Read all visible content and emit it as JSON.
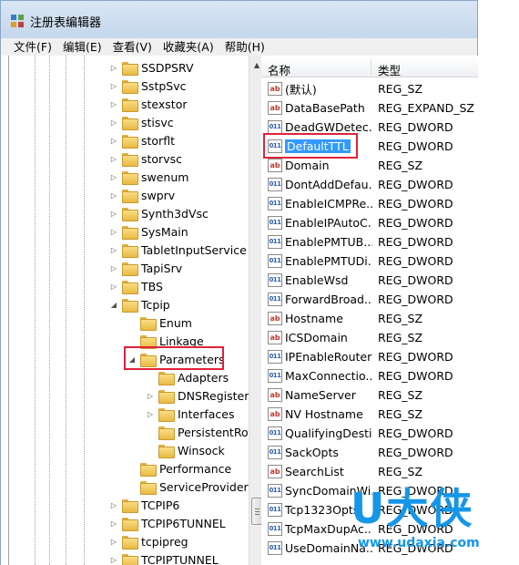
{
  "window": {
    "title": "注册表编辑器"
  },
  "menu": [
    "文件(F)",
    "编辑(E)",
    "查看(V)",
    "收藏夹(A)",
    "帮助(H)"
  ],
  "tree": {
    "items": [
      {
        "label": "SSDPSRV",
        "level": 0,
        "expander": "▷"
      },
      {
        "label": "SstpSvc",
        "level": 0,
        "expander": "▷"
      },
      {
        "label": "stexstor",
        "level": 0,
        "expander": "▷"
      },
      {
        "label": "stisvc",
        "level": 0,
        "expander": "▷"
      },
      {
        "label": "storflt",
        "level": 0,
        "expander": "▷"
      },
      {
        "label": "storvsc",
        "level": 0,
        "expander": "▷"
      },
      {
        "label": "swenum",
        "level": 0,
        "expander": "▷"
      },
      {
        "label": "swprv",
        "level": 0,
        "expander": "▷"
      },
      {
        "label": "Synth3dVsc",
        "level": 0,
        "expander": "▷"
      },
      {
        "label": "SysMain",
        "level": 0,
        "expander": "▷"
      },
      {
        "label": "TabletInputService",
        "level": 0,
        "expander": "▷"
      },
      {
        "label": "TapiSrv",
        "level": 0,
        "expander": "▷"
      },
      {
        "label": "TBS",
        "level": 0,
        "expander": "▷"
      },
      {
        "label": "Tcpip",
        "level": 0,
        "expander": "◢"
      },
      {
        "label": "Enum",
        "level": 1,
        "expander": ""
      },
      {
        "label": "Linkage",
        "level": 1,
        "expander": ""
      },
      {
        "label": "Parameters",
        "level": 1,
        "expander": "◢"
      },
      {
        "label": "Adapters",
        "level": 2,
        "expander": ""
      },
      {
        "label": "DNSRegistere",
        "level": 2,
        "expander": "▷"
      },
      {
        "label": "Interfaces",
        "level": 2,
        "expander": "▷"
      },
      {
        "label": "PersistentRou",
        "level": 2,
        "expander": ""
      },
      {
        "label": "Winsock",
        "level": 2,
        "expander": ""
      },
      {
        "label": "Performance",
        "level": 1,
        "expander": ""
      },
      {
        "label": "ServiceProvider",
        "level": 1,
        "expander": ""
      },
      {
        "label": "TCPIP6",
        "level": 0,
        "expander": "▷"
      },
      {
        "label": "TCPIP6TUNNEL",
        "level": 0,
        "expander": "▷"
      },
      {
        "label": "tcpipreg",
        "level": 0,
        "expander": "▷"
      },
      {
        "label": "TCPIPTUNNEL",
        "level": 0,
        "expander": "▷"
      }
    ]
  },
  "list": {
    "headers": {
      "name": "名称",
      "type": "类型"
    },
    "rows": [
      {
        "name": "(默认)",
        "type": "REG_SZ",
        "icon": "ab"
      },
      {
        "name": "DataBasePath",
        "type": "REG_EXPAND_SZ",
        "icon": "ab"
      },
      {
        "name": "DeadGWDetec...",
        "type": "REG_DWORD",
        "icon": "dw"
      },
      {
        "name": "DefaultTTL",
        "type": "REG_DWORD",
        "icon": "dw",
        "selected": true
      },
      {
        "name": "Domain",
        "type": "REG_SZ",
        "icon": "ab"
      },
      {
        "name": "DontAddDefau...",
        "type": "REG_DWORD",
        "icon": "dw"
      },
      {
        "name": "EnableICMPRe...",
        "type": "REG_DWORD",
        "icon": "dw"
      },
      {
        "name": "EnableIPAutoC...",
        "type": "REG_DWORD",
        "icon": "dw"
      },
      {
        "name": "EnablePMTUB...",
        "type": "REG_DWORD",
        "icon": "dw"
      },
      {
        "name": "EnablePMTUDi...",
        "type": "REG_DWORD",
        "icon": "dw"
      },
      {
        "name": "EnableWsd",
        "type": "REG_DWORD",
        "icon": "dw"
      },
      {
        "name": "ForwardBroad...",
        "type": "REG_DWORD",
        "icon": "dw"
      },
      {
        "name": "Hostname",
        "type": "REG_SZ",
        "icon": "ab"
      },
      {
        "name": "ICSDomain",
        "type": "REG_SZ",
        "icon": "ab"
      },
      {
        "name": "IPEnableRouter",
        "type": "REG_DWORD",
        "icon": "dw"
      },
      {
        "name": "MaxConnectio...",
        "type": "REG_DWORD",
        "icon": "dw"
      },
      {
        "name": "NameServer",
        "type": "REG_SZ",
        "icon": "ab"
      },
      {
        "name": "NV Hostname",
        "type": "REG_SZ",
        "icon": "ab"
      },
      {
        "name": "QualifyingDesti...",
        "type": "REG_DWORD",
        "icon": "dw"
      },
      {
        "name": "SackOpts",
        "type": "REG_DWORD",
        "icon": "dw"
      },
      {
        "name": "SearchList",
        "type": "REG_SZ",
        "icon": "ab"
      },
      {
        "name": "SyncDomainWi...",
        "type": "REG_DWORD",
        "icon": "dw"
      },
      {
        "name": "Tcp1323Opts",
        "type": "REG_DWORD",
        "icon": "dw"
      },
      {
        "name": "TcpMaxDupAc...",
        "type": "REG_DWORD",
        "icon": "dw"
      },
      {
        "name": "UseDomainNa...",
        "type": "REG_DWORD",
        "icon": "dw"
      }
    ]
  },
  "icons": {
    "string_value": "ab",
    "dword_value": "011"
  },
  "watermark": {
    "logo": "U大侠",
    "url": "www.udaxia.com"
  },
  "colors": {
    "selection": "#3399ff",
    "highlight": "#e0223a",
    "watermark": "#1596e8"
  }
}
